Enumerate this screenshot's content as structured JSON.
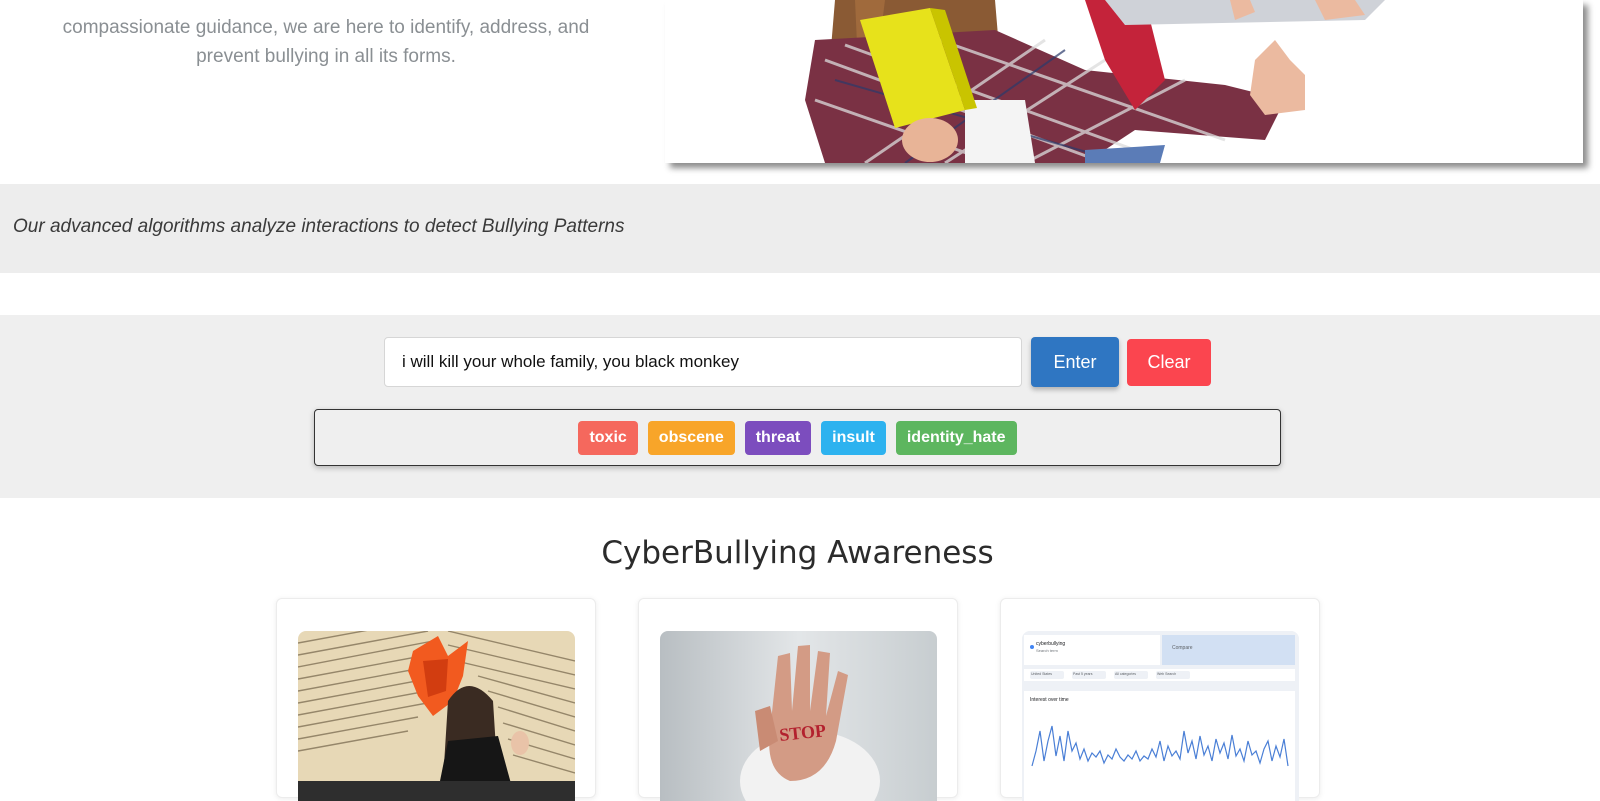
{
  "hero": {
    "text_line1": "compassionate guidance, we are here to identify, address, and",
    "text_line2": "prevent bullying in all its forms."
  },
  "band": {
    "text": "Our advanced algorithms analyze interactions to detect Bullying Patterns"
  },
  "classifier": {
    "input_value": "i will kill your whole family, you black monkey",
    "enter_label": "Enter",
    "clear_label": "Clear",
    "labels": [
      {
        "text": "toxic",
        "color": "#f5685d"
      },
      {
        "text": "obscene",
        "color": "#f8a529"
      },
      {
        "text": "threat",
        "color": "#7c4dbe"
      },
      {
        "text": "insult",
        "color": "#2db2ef"
      },
      {
        "text": "identity_hate",
        "color": "#5db65f"
      }
    ]
  },
  "awareness": {
    "title": "CyberBullying Awareness",
    "card3_search_term": "cyberbullying",
    "card3_search_sub": "Search term",
    "card3_compare": "Compare",
    "card3_filters": [
      "United States",
      "Past 5 years",
      "All categories",
      "Web Search"
    ],
    "card3_chart_title": "Interest over time"
  },
  "colors": {
    "accent_blue": "#2f76c2",
    "clear_red": "#fb454f",
    "band_gray": "#ededed"
  }
}
